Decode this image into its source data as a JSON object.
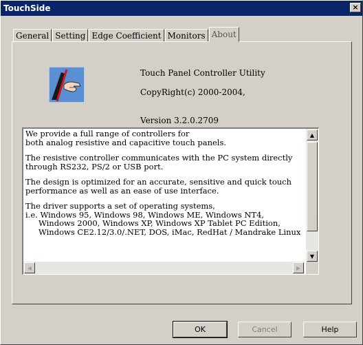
{
  "window": {
    "title": "TouchSide",
    "close_label": "×"
  },
  "tabs": [
    {
      "label": "General"
    },
    {
      "label": "Setting"
    },
    {
      "label": "Edge Coefficient"
    },
    {
      "label": "Monitors"
    },
    {
      "label": "About"
    }
  ],
  "about": {
    "product": "Touch Panel Controller Utility",
    "copyright": "CopyRight(c) 2000-2004,",
    "version": "Version 3.2.0.2709",
    "logo_icon": "touch-hand-logo-icon",
    "description": {
      "lines_p1": [
        "We provide a full range of controllers for",
        "both analog resistive and capacitive touch panels."
      ],
      "lines_p2": [
        "The resistive controller communicates with the PC system directly",
        "through RS232, PS/2 or USB port."
      ],
      "lines_p3": [
        "The design is optimized for an accurate, sensitive and quick touch",
        "performance as well as an ease of use interface."
      ],
      "lines_p4": [
        "The driver supports a set of operating systems,",
        "i.e. Windows 95, Windows 98, Windows ME, Windows NT4,",
        "Windows 2000, Windows XP, Windows XP Tablet PC Edition,",
        "Windows CE2.12/3.0/.NET, DOS, iMac, RedHat / Mandrake Linux"
      ]
    }
  },
  "buttons": {
    "ok": "OK",
    "cancel": "Cancel",
    "help": "Help"
  },
  "colors": {
    "titlebar": "#0a246a",
    "face": "#d4d0c8"
  }
}
